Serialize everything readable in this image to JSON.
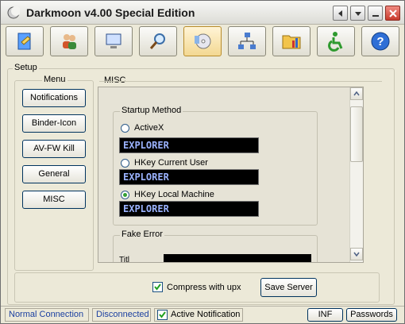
{
  "window": {
    "title": "Darkmoon v4.00 Special Edition"
  },
  "setup": {
    "label": "Setup",
    "menu_label": "Menu",
    "menu_items": [
      "Notifications",
      "Binder-Icon",
      "AV-FW Kill",
      "General",
      "MISC"
    ]
  },
  "misc": {
    "label": "MISC",
    "startup": {
      "label": "Startup Method",
      "options": [
        {
          "label": "ActiveX",
          "value": "EXPLORER",
          "checked": false
        },
        {
          "label": "HKey Current User",
          "value": "EXPLORER",
          "checked": false
        },
        {
          "label": "HKey Local Machine",
          "value": "EXPLORER",
          "checked": true
        }
      ]
    },
    "fake_error": {
      "label": "Fake Error",
      "title_label": "Titl"
    }
  },
  "bottom": {
    "compress_label": "Compress with upx",
    "compress_checked": true,
    "save_label": "Save Server"
  },
  "status": {
    "connection": "Normal Connection",
    "state": "Disconnected",
    "active_notification": "Active Notification",
    "active_checked": true,
    "inf_label": "INF",
    "passwords_label": "Passwords"
  },
  "colors": {
    "field_text": "#9bb3ff",
    "field_bg": "#000000",
    "window_bg": "#ece9d8"
  }
}
